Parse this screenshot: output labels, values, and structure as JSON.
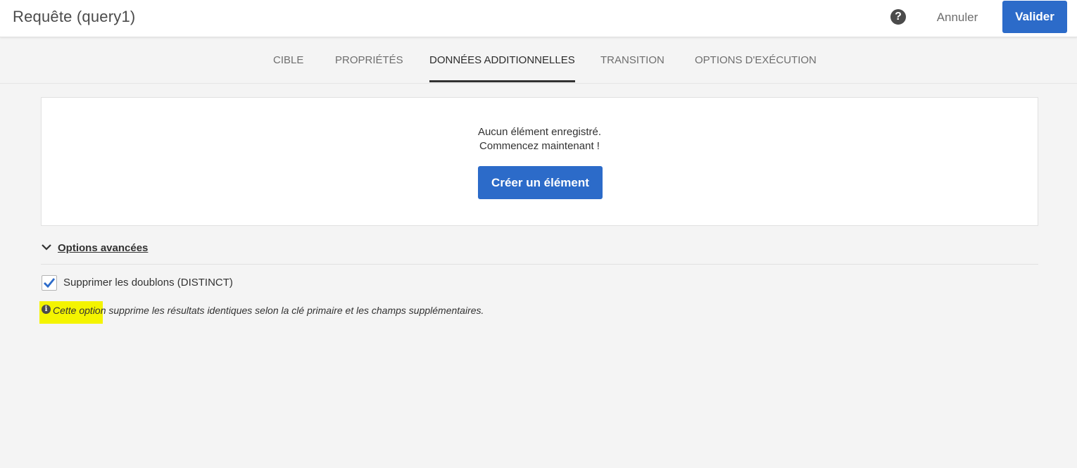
{
  "header": {
    "title": "Requête (query1)",
    "help_icon": "?",
    "cancel_label": "Annuler",
    "validate_label": "Valider",
    "accent_color": "#2c6bc9"
  },
  "tabs": [
    {
      "label": "CIBLE",
      "active": false
    },
    {
      "label": "PROPRIÉTÉS",
      "active": false
    },
    {
      "label": "DONNÉES ADDITIONNELLES",
      "active": true
    },
    {
      "label": "TRANSITION",
      "active": false
    },
    {
      "label": "OPTIONS D'EXÉCUTION",
      "active": false
    }
  ],
  "empty_state": {
    "line1": "Aucun élément enregistré.",
    "line2": "Commencez maintenant !",
    "create_label": "Créer un élément"
  },
  "advanced": {
    "toggle_label": "Options avancées",
    "expanded": true,
    "checkbox_label": "Supprimer les doublons (DISTINCT)",
    "checked": true,
    "info_icon": "i",
    "hint_text": "Cette option supprime les résultats identiques selon la clé primaire et les champs supplémentaires."
  }
}
